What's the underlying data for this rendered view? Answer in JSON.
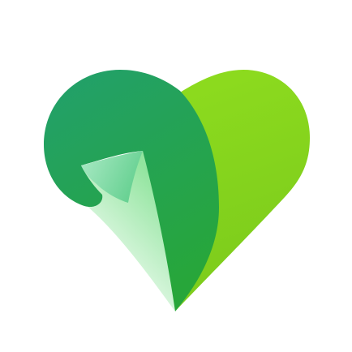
{
  "logo": {
    "icon": "green-heart-leaf-icon",
    "colors": {
      "background": "#ffffff",
      "right_lobe_top": "#8EDC1E",
      "right_lobe_bottom": "#7CCB1C",
      "left_lobe_top": "#22A06B",
      "left_lobe_bottom": "#27A63A",
      "curl_light": "#A6E8C2",
      "curl_mid": "#62CF8E",
      "shadow": "#7FE08E"
    }
  }
}
